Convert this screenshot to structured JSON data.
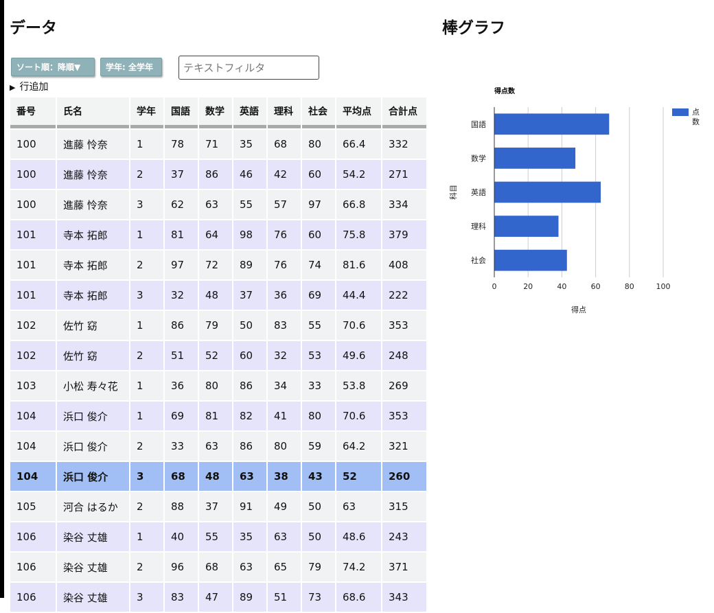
{
  "headings": {
    "data": "データ",
    "chart": "棒グラフ"
  },
  "controls": {
    "sort_label": "ソート順：降順▼",
    "grade_label": "学年: 全学年",
    "filter_placeholder": "テキストフィルタ",
    "filter_value": "",
    "add_row_label": "行追加",
    "add_row_icon": "triangle-right-icon"
  },
  "table": {
    "columns": [
      "番号",
      "氏名",
      "学年",
      "国語",
      "数学",
      "英語",
      "理科",
      "社会",
      "平均点",
      "合計点"
    ],
    "selected_row": 11,
    "rows": [
      [
        "100",
        "進藤 怜奈",
        "1",
        "78",
        "71",
        "35",
        "68",
        "80",
        "66.4",
        "332"
      ],
      [
        "100",
        "進藤 怜奈",
        "2",
        "37",
        "86",
        "46",
        "42",
        "60",
        "54.2",
        "271"
      ],
      [
        "100",
        "進藤 怜奈",
        "3",
        "62",
        "63",
        "55",
        "57",
        "97",
        "66.8",
        "334"
      ],
      [
        "101",
        "寺本 拓郎",
        "1",
        "81",
        "64",
        "98",
        "76",
        "60",
        "75.8",
        "379"
      ],
      [
        "101",
        "寺本 拓郎",
        "2",
        "97",
        "72",
        "89",
        "76",
        "74",
        "81.6",
        "408"
      ],
      [
        "101",
        "寺本 拓郎",
        "3",
        "32",
        "48",
        "37",
        "36",
        "69",
        "44.4",
        "222"
      ],
      [
        "102",
        "佐竹 窈",
        "1",
        "86",
        "79",
        "50",
        "83",
        "55",
        "70.6",
        "353"
      ],
      [
        "102",
        "佐竹 窈",
        "2",
        "51",
        "52",
        "60",
        "32",
        "53",
        "49.6",
        "248"
      ],
      [
        "103",
        "小松 寿々花",
        "1",
        "36",
        "80",
        "86",
        "34",
        "33",
        "53.8",
        "269"
      ],
      [
        "104",
        "浜口 俊介",
        "1",
        "69",
        "81",
        "82",
        "41",
        "80",
        "70.6",
        "353"
      ],
      [
        "104",
        "浜口 俊介",
        "2",
        "33",
        "63",
        "86",
        "80",
        "59",
        "64.2",
        "321"
      ],
      [
        "104",
        "浜口 俊介",
        "3",
        "68",
        "48",
        "63",
        "38",
        "43",
        "52",
        "260"
      ],
      [
        "105",
        "河合 はるか",
        "2",
        "88",
        "37",
        "91",
        "49",
        "50",
        "63",
        "315"
      ],
      [
        "106",
        "染谷 丈雄",
        "1",
        "40",
        "55",
        "35",
        "63",
        "50",
        "48.6",
        "243"
      ],
      [
        "106",
        "染谷 丈雄",
        "2",
        "96",
        "68",
        "63",
        "65",
        "79",
        "74.2",
        "371"
      ],
      [
        "106",
        "染谷 丈雄",
        "3",
        "83",
        "47",
        "89",
        "51",
        "73",
        "68.6",
        "343"
      ]
    ]
  },
  "chart_data": {
    "type": "bar",
    "orientation": "horizontal",
    "title": "得点数",
    "xlabel": "得点",
    "ylabel": "科目",
    "categories": [
      "国語",
      "数学",
      "英語",
      "理科",
      "社会"
    ],
    "series": [
      {
        "name": "点数",
        "values": [
          68,
          48,
          63,
          38,
          43
        ],
        "color": "#3366cc"
      }
    ],
    "xlim": [
      0,
      100
    ],
    "xticks": [
      0,
      20,
      40,
      60,
      80,
      100
    ],
    "grid": true,
    "legend": "right"
  }
}
